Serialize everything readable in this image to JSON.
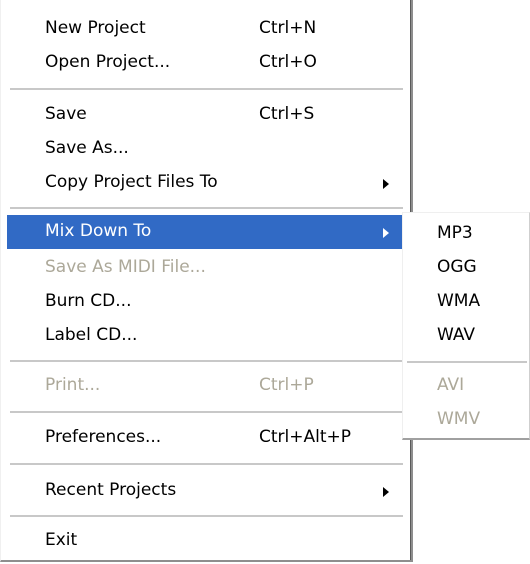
{
  "menu": {
    "items": [
      {
        "label": "New Project",
        "shortcut": "Ctrl+N"
      },
      {
        "label": "Open Project...",
        "shortcut": "Ctrl+O"
      },
      {
        "label": "Save",
        "shortcut": "Ctrl+S"
      },
      {
        "label": "Save As..."
      },
      {
        "label": "Copy Project Files To",
        "submenu": true
      },
      {
        "label": "Mix Down To",
        "submenu": true,
        "highlighted": true
      },
      {
        "label": "Save As MIDI File...",
        "disabled": true
      },
      {
        "label": "Burn CD..."
      },
      {
        "label": "Label CD..."
      },
      {
        "label": "Print...",
        "shortcut": "Ctrl+P",
        "disabled": true
      },
      {
        "label": "Preferences...",
        "shortcut": "Ctrl+Alt+P"
      },
      {
        "label": "Recent Projects",
        "submenu": true
      },
      {
        "label": "Exit"
      }
    ]
  },
  "submenu": {
    "items": [
      {
        "label": "MP3"
      },
      {
        "label": "OGG"
      },
      {
        "label": "WMA"
      },
      {
        "label": "WAV"
      },
      {
        "label": "AVI",
        "disabled": true
      },
      {
        "label": "WMV",
        "disabled": true
      }
    ]
  },
  "colors": {
    "highlight": "#316ac5",
    "disabled_text": "#aca899",
    "separator": "#c8c8c8"
  }
}
